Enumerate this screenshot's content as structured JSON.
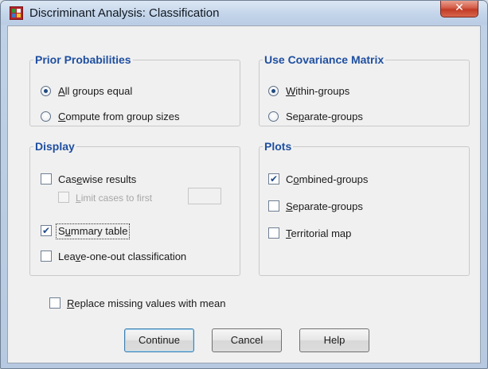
{
  "window": {
    "title": "Discriminant Analysis: Classification",
    "close_glyph": "✕"
  },
  "prior": {
    "title": "Prior Probabilities",
    "options": [
      {
        "pre": "",
        "key": "A",
        "post": "ll groups equal",
        "checked": true
      },
      {
        "pre": "",
        "key": "C",
        "post": "ompute from group sizes",
        "checked": false
      }
    ]
  },
  "covariance": {
    "title": "Use Covariance Matrix",
    "options": [
      {
        "pre": "",
        "key": "W",
        "post": "ithin-groups",
        "checked": true
      },
      {
        "pre": "Se",
        "key": "p",
        "post": "arate-groups",
        "checked": false
      }
    ]
  },
  "display": {
    "title": "Display",
    "casewise": {
      "pre": "Cas",
      "key": "e",
      "post": "wise results",
      "checked": false
    },
    "limit": {
      "pre": "",
      "key": "L",
      "post": "imit cases to first",
      "checked": false,
      "enabled": false,
      "value": ""
    },
    "summary": {
      "pre": "S",
      "key": "u",
      "post": "mmary table",
      "checked": true
    },
    "leave_one_out": {
      "pre": "Lea",
      "key": "v",
      "post": "e-one-out classification",
      "checked": false
    }
  },
  "plots": {
    "title": "Plots",
    "options": [
      {
        "pre": "C",
        "key": "o",
        "post": "mbined-groups",
        "checked": true
      },
      {
        "pre": "",
        "key": "S",
        "post": "eparate-groups",
        "checked": false
      },
      {
        "pre": "",
        "key": "T",
        "post": "erritorial map",
        "checked": false
      }
    ]
  },
  "replace_missing": {
    "pre": "",
    "key": "R",
    "post": "eplace missing values with mean",
    "checked": false
  },
  "buttons": {
    "continue": "Continue",
    "cancel": "Cancel",
    "help": "Help"
  },
  "check_glyph": "✔",
  "colors": {
    "group_title": "#1f4fa0",
    "close_button": "#c23b26",
    "checkmark": "#204a8a"
  }
}
